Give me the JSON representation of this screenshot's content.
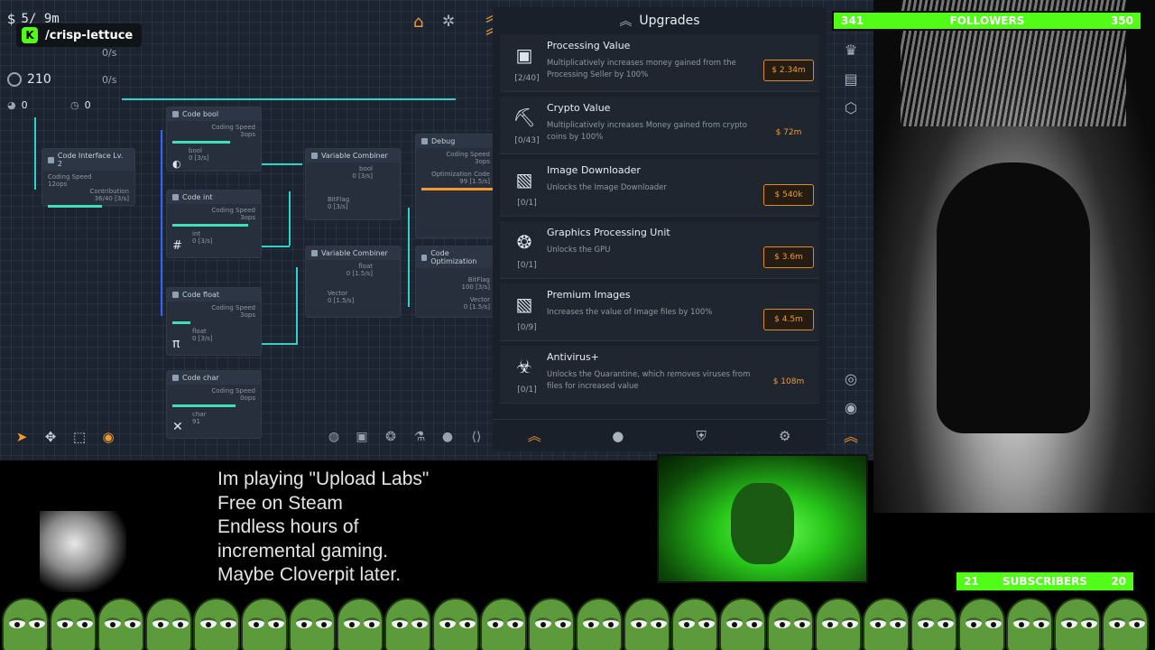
{
  "stream": {
    "channel": "/crisp-lettuce",
    "followers_label": "FOLLOWERS",
    "followers_current": "341",
    "followers_goal": "350",
    "subscribers_label": "SUBSCRIBERS",
    "subscribers_current": "21",
    "subscribers_goal": "20",
    "caption_lines": [
      "Im playing \"Upload Labs\"",
      "Free on Steam",
      "Endless hours of",
      "incremental gaming.",
      "Maybe Cloverpit later."
    ],
    "accent": "#53fc18"
  },
  "stats": {
    "money": "5/ 9m",
    "data_value": "210",
    "data_rate": "0/s",
    "top_rate": "0/s",
    "counter_a": "0",
    "counter_b": "0"
  },
  "nodes": [
    {
      "title": "Code Interface Lv. 2",
      "l1": "Coding Speed",
      "l2": "12ops",
      "l3": "Contribution",
      "l4": "36/40 [3/s]"
    },
    {
      "title": "Code bool",
      "l1": "Coding Speed",
      "l2": "3ops",
      "l3": "bool",
      "l4": "0 [3/s]"
    },
    {
      "title": "Code int",
      "l1": "Coding Speed",
      "l2": "3ops",
      "l3": "int",
      "l4": "0 [3/s]"
    },
    {
      "title": "Code float",
      "l1": "Coding Speed",
      "l2": "3ops",
      "l3": "float",
      "l4": "0 [3/s]"
    },
    {
      "title": "Code char",
      "l1": "Coding Speed",
      "l2": "0ops",
      "l3": "char",
      "l4": "91"
    },
    {
      "title": "Variable Combiner",
      "l1": "bool",
      "l2": "0 [3/s]",
      "l3": "BitFlag",
      "l4": "0 [3/s]"
    },
    {
      "title": "Variable Combiner",
      "l1": "float",
      "l2": "0 [1.5/s]",
      "l3": "Vector",
      "l4": "0 [1.5/s]"
    },
    {
      "title": "Debug",
      "l1": "Coding Speed",
      "l2": "3ops",
      "l3": "Optimization Code",
      "l4": "99 [1.5/s]"
    },
    {
      "title": "Code Optimization",
      "l1": "BitFlag",
      "l2": "100 [3/s]",
      "l3": "Vector",
      "l4": "0 [1.5/s]"
    }
  ],
  "upgrades": {
    "title": "Upgrades",
    "items": [
      {
        "name": "Processing Value",
        "count": "[2/40]",
        "desc": "Multiplicatively increases money gained from the Processing Seller by 100%",
        "price": "$ 2.34m",
        "icon": "chip-icon",
        "affordable": true
      },
      {
        "name": "Crypto Value",
        "count": "[0/43]",
        "desc": "Multiplicatively increases Money gained from crypto coins by 100%",
        "price": "$ 72m",
        "icon": "pickaxe-icon",
        "affordable": false
      },
      {
        "name": "Image Downloader",
        "count": "[0/1]",
        "desc": "Unlocks the Image Downloader",
        "price": "$ 540k",
        "icon": "image-icon",
        "affordable": true
      },
      {
        "name": "Graphics Processing Unit",
        "count": "[0/1]",
        "desc": "Unlocks the GPU",
        "price": "$ 3.6m",
        "icon": "gpu-fan-icon",
        "affordable": true
      },
      {
        "name": "Premium Images",
        "count": "[0/9]",
        "desc": "Increases the value of Image files by 100%",
        "price": "$ 4.5m",
        "icon": "image-icon",
        "affordable": true
      },
      {
        "name": "Antivirus+",
        "count": "[0/1]",
        "desc": "Unlocks the Quarantine, which removes viruses from files for increased value",
        "price": "$ 108m",
        "icon": "biohazard-icon",
        "affordable": false
      }
    ]
  }
}
